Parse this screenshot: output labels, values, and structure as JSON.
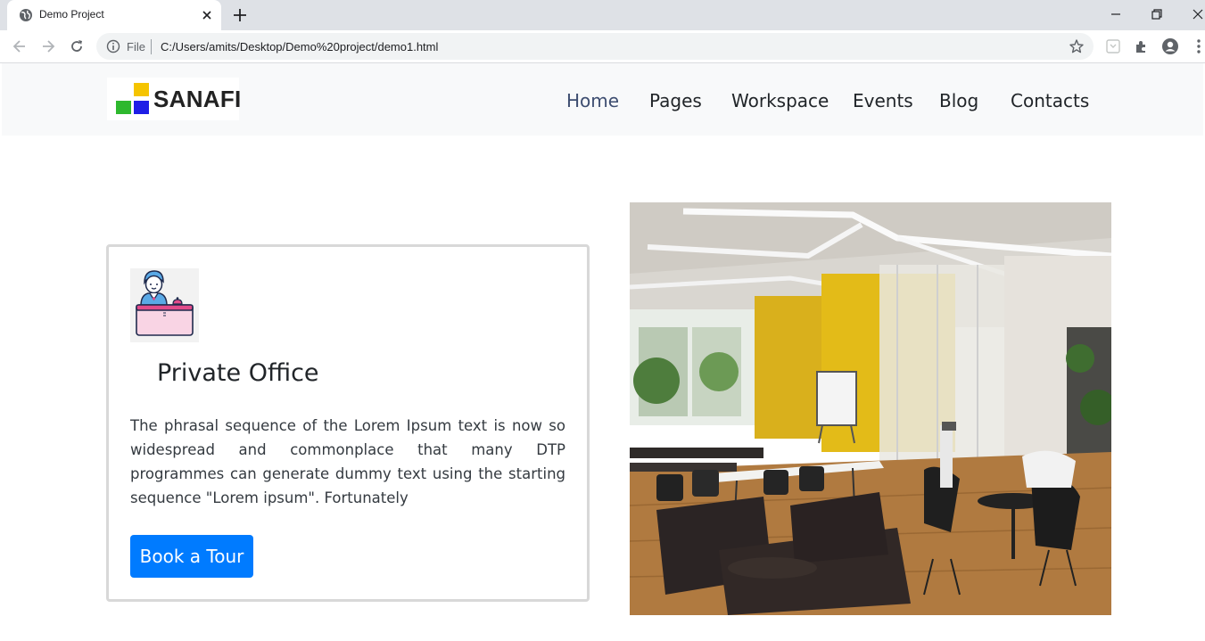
{
  "browser": {
    "tab_title": "Demo Project",
    "omnibox_scheme_label": "File",
    "url": "C:/Users/amits/Desktop/Demo%20project/demo1.html"
  },
  "site": {
    "logo_text": "SANAFI",
    "menu": [
      {
        "label": "Home",
        "active": true
      },
      {
        "label": "Pages",
        "active": false
      },
      {
        "label": "Workspace",
        "active": false
      },
      {
        "label": "Events",
        "active": false
      },
      {
        "label": "Blog",
        "active": false
      },
      {
        "label": "Contacts",
        "active": false
      }
    ],
    "colors": {
      "logo_yellow": "#f5c400",
      "logo_green": "#2eb82e",
      "logo_blue": "#1e1ee6",
      "button_blue": "#007bff",
      "active_link": "#3d4d70"
    }
  },
  "card": {
    "icon": "receptionist-desk-icon",
    "title": "Private Office",
    "text": "The phrasal sequence of the Lorem Ipsum text is now so widespread and commonplace that many DTP programmes can generate dummy text using the starting sequence \"Lorem ipsum\". Fortunately",
    "button_label": "Book a Tour"
  },
  "photo": {
    "subject": "office-interior-photo"
  }
}
